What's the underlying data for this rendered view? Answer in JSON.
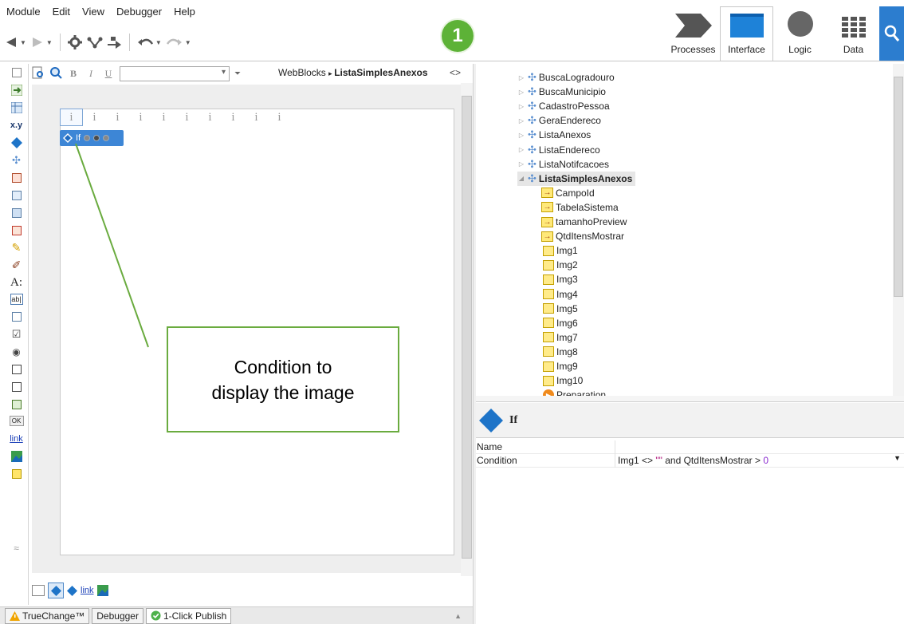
{
  "menu": {
    "items": [
      "Module",
      "Edit",
      "View",
      "Debugger",
      "Help"
    ]
  },
  "badge": {
    "number": "1"
  },
  "top_tabs": [
    {
      "label": "Processes",
      "active": false
    },
    {
      "label": "Interface",
      "active": true
    },
    {
      "label": "Logic",
      "active": false
    },
    {
      "label": "Data",
      "active": false
    }
  ],
  "editor": {
    "format_bold": "B",
    "format_italic": "I",
    "format_underline": "U",
    "breadcrumb_parent": "WebBlocks",
    "breadcrumb_current": "ListaSimplesAnexos",
    "collapse_label": "<>",
    "placeholder_glyph": "i",
    "if_widget_label": "If"
  },
  "palette": {
    "xy_label": "x.y",
    "text_label": "A:",
    "input_label": "ab|",
    "ok_label": "OK",
    "link_label": "link"
  },
  "bottom_strip": {
    "link_label": "link"
  },
  "bottom_tabs": [
    {
      "label": "TrueChange™",
      "icon": "warning-icon"
    },
    {
      "label": "Debugger",
      "icon": ""
    },
    {
      "label": "1-Click Publish",
      "icon": "check-circle-icon",
      "active": true
    }
  ],
  "tree": {
    "webblocks": [
      "BuscaLogradouro",
      "BuscaMunicipio",
      "CadastroPessoa",
      "GeraEndereco",
      "ListaAnexos",
      "ListaEndereco",
      "ListaNotifcacoes"
    ],
    "selected": "ListaSimplesAnexos",
    "inputs": [
      "CampoId",
      "TabelaSistema",
      "tamanhoPreview",
      "QtdItensMostrar"
    ],
    "variables": [
      "Img1",
      "Img2",
      "Img3",
      "Img4",
      "Img5",
      "Img6",
      "Img7",
      "Img8",
      "Img9",
      "Img10"
    ],
    "action": "Preparation"
  },
  "properties": {
    "title": "If",
    "rows": [
      {
        "key": "Name",
        "value": ""
      },
      {
        "key": "Condition",
        "value_prefix": "Img1 <> ",
        "value_string": "\"\"",
        "value_middle": " and QtdItensMostrar > ",
        "value_number": "0"
      }
    ]
  },
  "annotation": {
    "text_line1": "Condition to",
    "text_line2": "display the image"
  }
}
